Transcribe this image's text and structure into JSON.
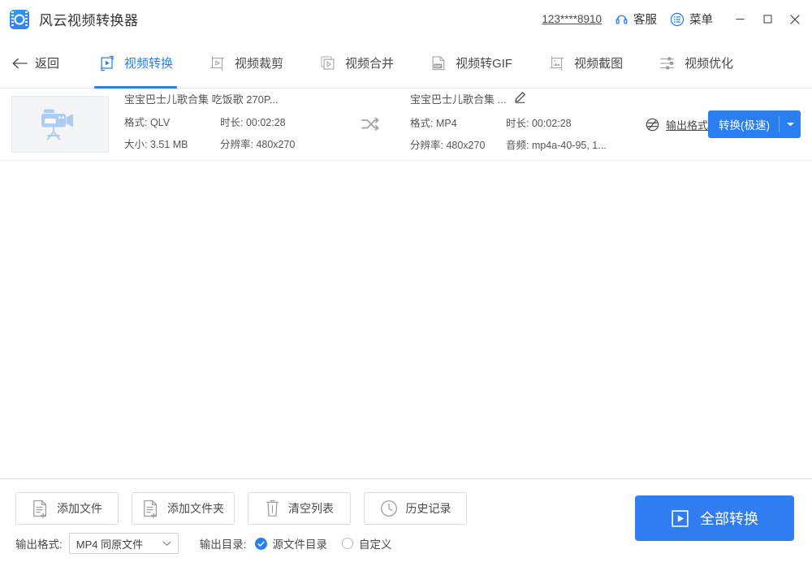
{
  "titlebar": {
    "app_name": "风云视频转换器",
    "app_icon": "film-reel-icon",
    "account": "123****8910",
    "support_label": "客服",
    "menu_label": "菜单",
    "minimize": "—",
    "maximize": "□",
    "close": "✕"
  },
  "nav": {
    "back_label": "返回",
    "tabs": [
      {
        "label": "视频转换",
        "icon": "video-convert-icon",
        "active": true
      },
      {
        "label": "视频裁剪",
        "icon": "video-crop-icon",
        "active": false
      },
      {
        "label": "视频合并",
        "icon": "video-merge-icon",
        "active": false
      },
      {
        "label": "视频转GIF",
        "icon": "video-to-gif-icon",
        "active": false
      },
      {
        "label": "视频截图",
        "icon": "video-screenshot-icon",
        "active": false
      },
      {
        "label": "视频优化",
        "icon": "video-optimize-icon",
        "active": false
      }
    ]
  },
  "file_row": {
    "thumbnail_icon": "video-camera-icon",
    "source": {
      "title": "宝宝巴士儿歌合集 吃饭歌 270P...",
      "format_label": "格式: QLV",
      "duration_label": "时长: 00:02:28",
      "size_label": "大小: 3.51 MB",
      "resolution_label": "分辨率: 480x270"
    },
    "swap_icon": "shuffle-icon",
    "output": {
      "title": "宝宝巴士儿歌合集 ...",
      "edit_icon": "pencil-icon",
      "format_label": "格式: MP4",
      "duration_label": "时长: 00:02:28",
      "resolution_label": "分辨率: 480x270",
      "audio_label": "音频: mp4a-40-95, 1..."
    },
    "format_link": {
      "icon": "format-settings-icon",
      "label": "输出格式"
    },
    "convert_button": {
      "label": "转换(极速)",
      "arrow": "▼"
    }
  },
  "bottom": {
    "tools": [
      {
        "label": "添加文件",
        "icon": "add-file-icon"
      },
      {
        "label": "添加文件夹",
        "icon": "add-folder-icon"
      },
      {
        "label": "清空列表",
        "icon": "trash-icon"
      },
      {
        "label": "历史记录",
        "icon": "clock-icon"
      }
    ],
    "output_format_label": "输出格式:",
    "output_format_value": "MP4 同原文件",
    "output_format_arrow": "▼",
    "output_dir_label": "输出目录:",
    "dir_option_source": "源文件目录",
    "dir_option_custom": "自定义",
    "dir_selected": "源文件目录",
    "convert_all": {
      "label": "全部转换",
      "icon": "play-icon"
    }
  },
  "colors": {
    "accent": "#2a7ef0",
    "convert_all_bg": "#2f7df0",
    "text_primary": "#333333",
    "text_secondary": "#555555",
    "border": "#e6e6e6",
    "thumb_bg": "#f4f5f7",
    "thumb_icon": "#aecbf5"
  }
}
